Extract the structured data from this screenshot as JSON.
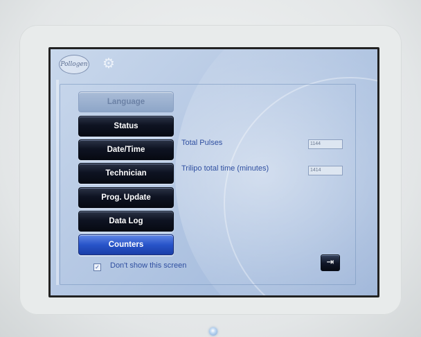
{
  "branding": {
    "logo_text": "Pollogen"
  },
  "icons": {
    "settings": "gear-icon",
    "exit": "exit-arrow-icon",
    "check": "checkmark-icon"
  },
  "menu": {
    "items": [
      {
        "label": "Language",
        "state": "disabled"
      },
      {
        "label": "Status",
        "state": "normal"
      },
      {
        "label": "Date/Time",
        "state": "normal"
      },
      {
        "label": "Technician",
        "state": "normal"
      },
      {
        "label": "Prog. Update",
        "state": "normal"
      },
      {
        "label": "Data Log",
        "state": "normal"
      },
      {
        "label": "Counters",
        "state": "selected"
      }
    ]
  },
  "counters": {
    "total_pulses_label": "Total Pulses",
    "total_pulses_value": "1144",
    "trilipo_time_label": "Trilipo total time (minutes)",
    "trilipo_time_value": "1414"
  },
  "footer": {
    "dont_show_label": "Don't show this screen",
    "dont_show_checked": true
  },
  "colors": {
    "accent_selected": "#2854c9",
    "label_text": "#2f4fa0",
    "button_dark": "#0e1322"
  }
}
